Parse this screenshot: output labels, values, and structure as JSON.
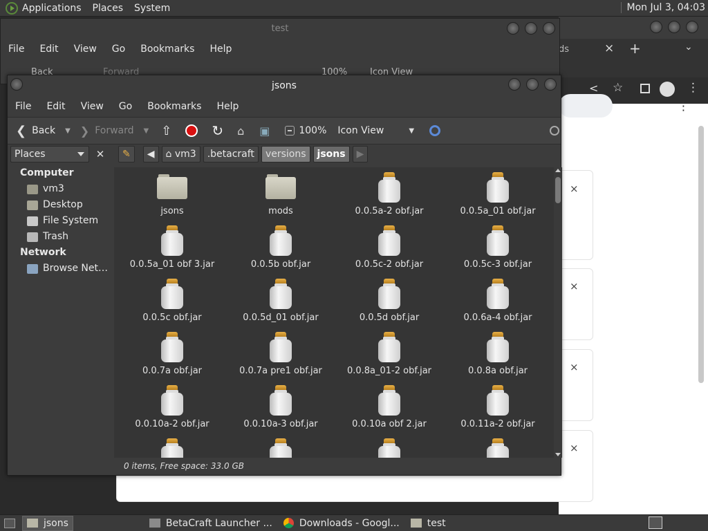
{
  "top_panel": {
    "menus": [
      "Applications",
      "Places",
      "System"
    ],
    "clock": "Mon Jul 3, 04:03"
  },
  "chrome": {
    "tab_text": "ds",
    "close_tab": "×",
    "new_tab": "+",
    "tab_menu": "⌄",
    "card_close": "×"
  },
  "test_window": {
    "title": "test",
    "menus": [
      "File",
      "Edit",
      "View",
      "Go",
      "Bookmarks",
      "Help"
    ],
    "toolbar": {
      "back": "Back",
      "forward": "Forward",
      "zoom": "100%",
      "view": "Icon View"
    }
  },
  "jsons_window": {
    "title": "jsons",
    "menus": [
      "File",
      "Edit",
      "View",
      "Go",
      "Bookmarks",
      "Help"
    ],
    "toolbar": {
      "back": "Back",
      "forward": "Forward",
      "zoom": "100%",
      "view": "Icon View"
    },
    "places_label": "Places",
    "breadcrumbs": [
      "vm3",
      ".betacraft",
      "versions",
      "jsons"
    ],
    "sidebar": {
      "computer_header": "Computer",
      "computer_items": [
        "vm3",
        "Desktop",
        "File System",
        "Trash"
      ],
      "network_header": "Network",
      "network_items": [
        "Browse Net…"
      ]
    },
    "files": [
      {
        "name": "jsons",
        "type": "folder"
      },
      {
        "name": "mods",
        "type": "folder"
      },
      {
        "name": "0.0.5a-2 obf.jar",
        "type": "jar"
      },
      {
        "name": "0.0.5a_01 obf.jar",
        "type": "jar"
      },
      {
        "name": "0.0.5a_01 obf 3.jar",
        "type": "jar"
      },
      {
        "name": "0.0.5b obf.jar",
        "type": "jar"
      },
      {
        "name": "0.0.5c-2 obf.jar",
        "type": "jar"
      },
      {
        "name": "0.0.5c-3 obf.jar",
        "type": "jar"
      },
      {
        "name": "0.0.5c obf.jar",
        "type": "jar"
      },
      {
        "name": "0.0.5d_01 obf.jar",
        "type": "jar"
      },
      {
        "name": "0.0.5d obf.jar",
        "type": "jar"
      },
      {
        "name": "0.0.6a-4 obf.jar",
        "type": "jar"
      },
      {
        "name": "0.0.7a obf.jar",
        "type": "jar"
      },
      {
        "name": "0.0.7a pre1 obf.jar",
        "type": "jar"
      },
      {
        "name": "0.0.8a_01-2 obf.jar",
        "type": "jar"
      },
      {
        "name": "0.0.8a obf.jar",
        "type": "jar"
      },
      {
        "name": "0.0.10a-2 obf.jar",
        "type": "jar"
      },
      {
        "name": "0.0.10a-3 obf.jar",
        "type": "jar"
      },
      {
        "name": "0.0.10a obf 2.jar",
        "type": "jar"
      },
      {
        "name": "0.0.11a-2 obf.jar",
        "type": "jar"
      },
      {
        "name": "",
        "type": "jar"
      },
      {
        "name": "",
        "type": "jar"
      },
      {
        "name": "",
        "type": "jar"
      },
      {
        "name": "",
        "type": "jar"
      }
    ],
    "status": "0 items, Free space: 33.0 GB"
  },
  "taskbar": {
    "tasks": [
      "jsons",
      "BetaCraft Launcher ...",
      "Downloads - Googl...",
      "test"
    ]
  }
}
